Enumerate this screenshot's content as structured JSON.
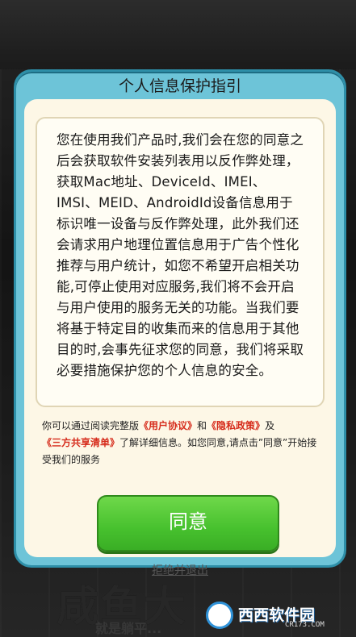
{
  "dialog": {
    "title": "个人信息保护指引",
    "policy_text": "您在使用我们产品时,我们会在您的同意之后会获取软件安装列表用以反作弊处理，获取Mac地址、DeviceId、IMEI、IMSI、MEID、AndroidId设备信息用于标识唯一设备与反作弊处理，此外我们还会请求用户地理位置信息用于广告个性化推荐与用户统计，如您不希望开启相关功能,可停止使用对应服务,我们将不会开启与用户使用的服务无关的功能。当我们要将基于特定目的收集而来的信息用于其他目的时,会事先征求您的同意，我们将采取必要措施保护您的个人信息的安全。",
    "notice": {
      "part1": "你可以通过阅读完整版",
      "user_agreement": "《用户协议》",
      "and": "和",
      "privacy_policy": "《隐私政策》",
      "and2": "及",
      "third_party": "《三方共享清单》",
      "part2": "了解详细信息。如您同意,请点击”同意”开始接受我们的服务"
    },
    "agree_button": "同意",
    "reject_link": "拒绝并退出"
  },
  "background": {
    "title_fragment": "咸鱼大",
    "subtitle_fragment": "就是躺平..."
  },
  "watermark": {
    "name": "西西软件园",
    "domain": "CR173.COM"
  }
}
